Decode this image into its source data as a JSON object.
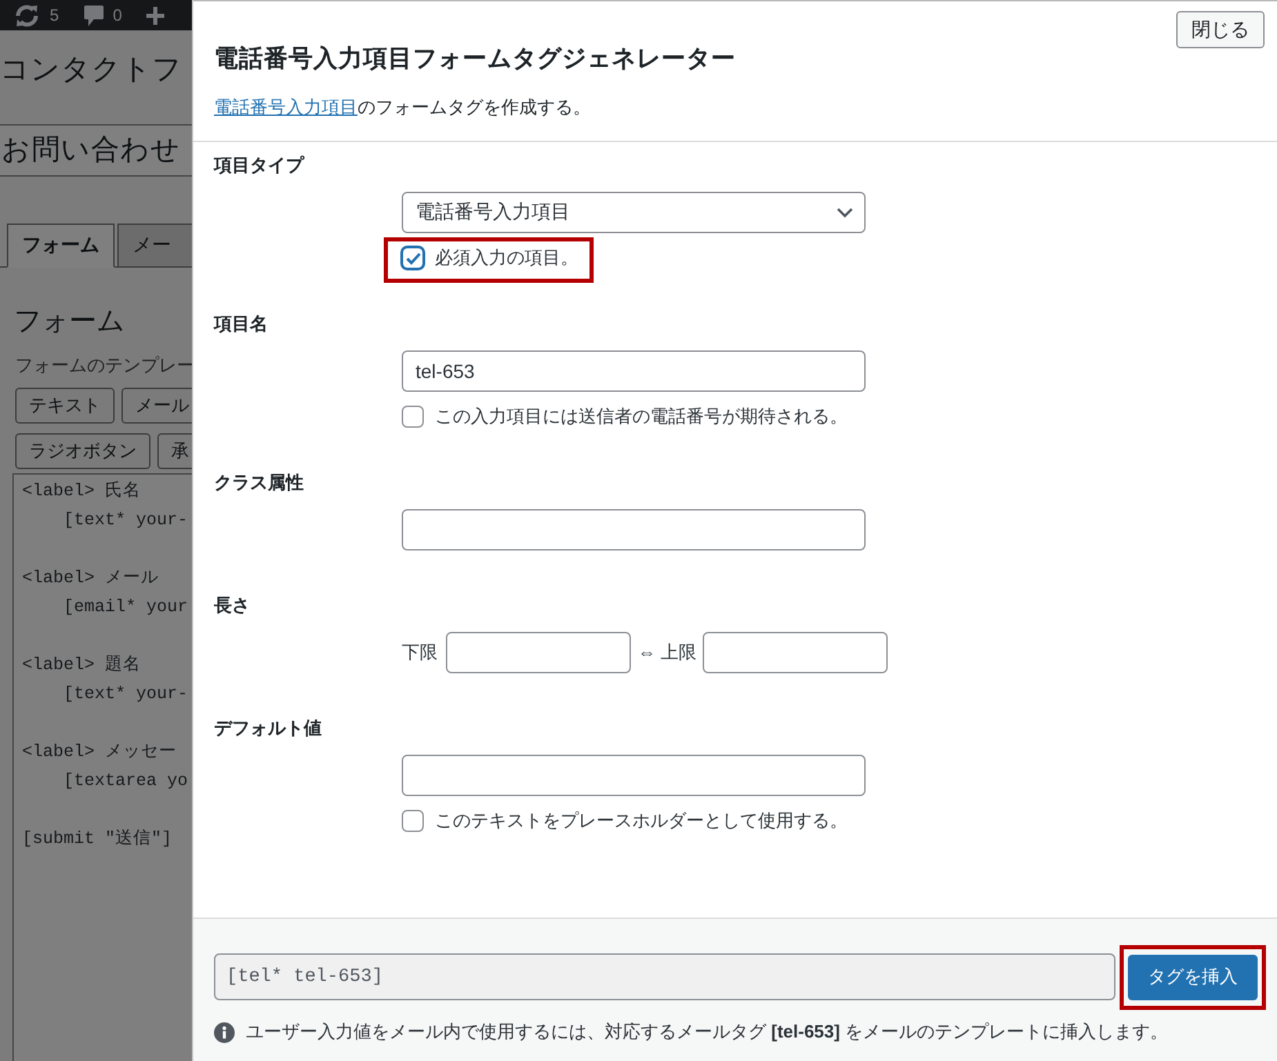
{
  "admin_bar": {
    "items": [
      {
        "kind": "updates",
        "count": "5"
      },
      {
        "kind": "comments",
        "count": "0"
      },
      {
        "kind": "new"
      }
    ]
  },
  "page": {
    "title": "コンタクトフ",
    "form_name": "お問い合わせ",
    "tabs": [
      {
        "label": "フォーム",
        "selected": true
      },
      {
        "label": "メー",
        "selected": false
      }
    ],
    "section_title": "フォーム",
    "description": "フォームのテンプレー",
    "tag_buttons": [
      [
        "テキスト",
        "メール"
      ],
      [
        "ラジオボタン",
        "承"
      ]
    ],
    "template": [
      {
        "text": "<label> 氏名",
        "children": [
          {
            "text": "[text* your-"
          }
        ]
      },
      {
        "text": "<label> メール",
        "children": [
          {
            "text": "[email* your"
          }
        ]
      },
      {
        "text": "<label> 題名",
        "children": [
          {
            "text": "[text* your-"
          }
        ]
      },
      {
        "text": "<label> メッセー",
        "children": [
          {
            "text": "[textarea yo"
          }
        ]
      },
      {
        "text": "[submit \"送信\"]"
      }
    ]
  },
  "dialog": {
    "title": "電話番号入力項目フォームタグジェネレーター",
    "close_button": "閉じる",
    "intro_link": "電話番号入力項目",
    "intro_text": "のフォームタグを作成する。",
    "fields": [
      {
        "kind": "select",
        "label": "項目タイプ",
        "value": "電話番号入力項目",
        "options": [
          {
            "label": "必須入力の項目。",
            "checked": true,
            "highlighted": true
          }
        ]
      },
      {
        "kind": "text",
        "label": "項目名",
        "value": "tel-653",
        "options": [
          {
            "label": "この入力項目には送信者の電話番号が期待される。",
            "checked": false,
            "highlighted": false
          }
        ]
      },
      {
        "kind": "text",
        "label": "クラス属性"
      },
      {
        "kind": "range",
        "label": "長さ",
        "min_label": "下限",
        "max_label": "⇔ 上限"
      },
      {
        "kind": "text",
        "label": "デフォルト値",
        "options": [
          {
            "label": "このテキストをプレースホルダーとして使用する。",
            "checked": false,
            "highlighted": false
          }
        ]
      }
    ],
    "footer": {
      "tag_code": "[tel* tel-653]",
      "insert_button": {
        "label": "タグを挿入",
        "highlighted": true
      },
      "note": "ユーザー入力値をメール内で使用するには、対応するメールタグ **[tel-653]** をメールのテンプレートに挿入します。"
    }
  }
}
